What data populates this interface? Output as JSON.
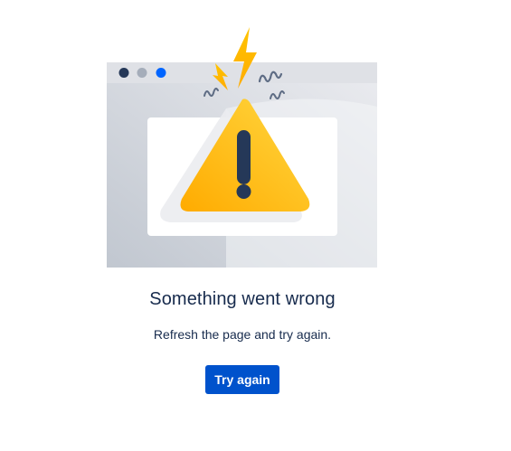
{
  "error": {
    "title": "Something went wrong",
    "message": "Refresh the page and try again.",
    "retry_label": "Try again"
  },
  "illustration": {
    "icon": "warning-triangle-icon",
    "window_dots": [
      "#253858",
      "#a5adba",
      "#0065ff"
    ],
    "warning_colors": [
      "#ffab00",
      "#ffd740"
    ]
  },
  "colors": {
    "accent": "#0052cc",
    "text": "#172b4d"
  }
}
